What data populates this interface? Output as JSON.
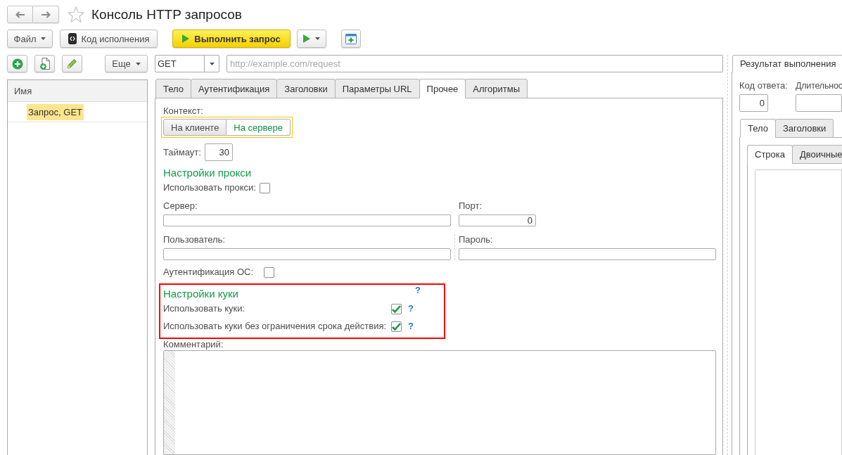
{
  "window": {
    "title": "Консоль HTTP запросов"
  },
  "command_bar": [
    {
      "kind": "menu",
      "label": "Файл"
    },
    {
      "kind": "code",
      "label": "Код исполнения"
    },
    {
      "kind": "primary",
      "label": "Выполнить запрос"
    },
    {
      "kind": "run-menu"
    },
    {
      "kind": "new-window"
    }
  ],
  "list_panel": {
    "toolbar": [
      {
        "kind": "add"
      },
      {
        "kind": "copy"
      },
      {
        "kind": "edit"
      },
      {
        "kind": "more",
        "label": "Еще"
      }
    ],
    "columns": [
      "Имя"
    ],
    "rows": [
      {
        "name": "Запрос, GET",
        "selected": true
      }
    ]
  },
  "request": {
    "method": "GET",
    "url": {
      "placeholder": "http://example.com/request"
    }
  },
  "request_tabs": [
    {
      "label": "Тело",
      "selected": false
    },
    {
      "label": "Аутентификация",
      "selected": false
    },
    {
      "label": "Заголовки",
      "selected": false
    },
    {
      "label": "Параметры URL",
      "selected": false
    },
    {
      "label": "Прочее",
      "selected": true
    },
    {
      "label": "Алгоритмы",
      "selected": false
    }
  ],
  "other_settings": {
    "context": {
      "label": "Контекст:",
      "options": [
        {
          "label": "На клиенте",
          "selected": false
        },
        {
          "label": "На сервере",
          "selected": true
        }
      ]
    },
    "timeout": {
      "label": "Таймаут:",
      "value": "30"
    },
    "proxy": {
      "heading": "Настройки прокси",
      "use_proxy": {
        "label": "Использовать прокси:",
        "checked": false
      },
      "server": {
        "label": "Сервер:"
      },
      "port": {
        "label": "Порт:",
        "value": "0"
      },
      "user": {
        "label": "Пользователь:"
      },
      "password": {
        "label": "Пароль:"
      },
      "os_auth": {
        "label": "Аутентификация ОС:",
        "checked": false
      }
    },
    "cookies": {
      "highlighted": true,
      "heading": "Настройки куки",
      "help": "?",
      "options": [
        {
          "label": "Использовать куки:",
          "checked": true,
          "help": "?"
        },
        {
          "label": "Использовать куки без ограничения срока действия:",
          "checked": true,
          "help": "?"
        }
      ]
    },
    "comment": {
      "label": "Комментарий:"
    }
  },
  "result_panel": {
    "tabs": [
      {
        "label": "Результат выполнения",
        "selected": true
      }
    ],
    "response_code": {
      "label": "Код ответа:",
      "value": "0"
    },
    "duration": {
      "label": "Длительнос"
    },
    "body_tabs": [
      {
        "label": "Тело",
        "selected": true
      },
      {
        "label": "Заголовки",
        "selected": false
      }
    ],
    "format_tabs": [
      {
        "label": "Строка",
        "selected": true
      },
      {
        "label": "Двоичные",
        "selected": false
      }
    ]
  }
}
